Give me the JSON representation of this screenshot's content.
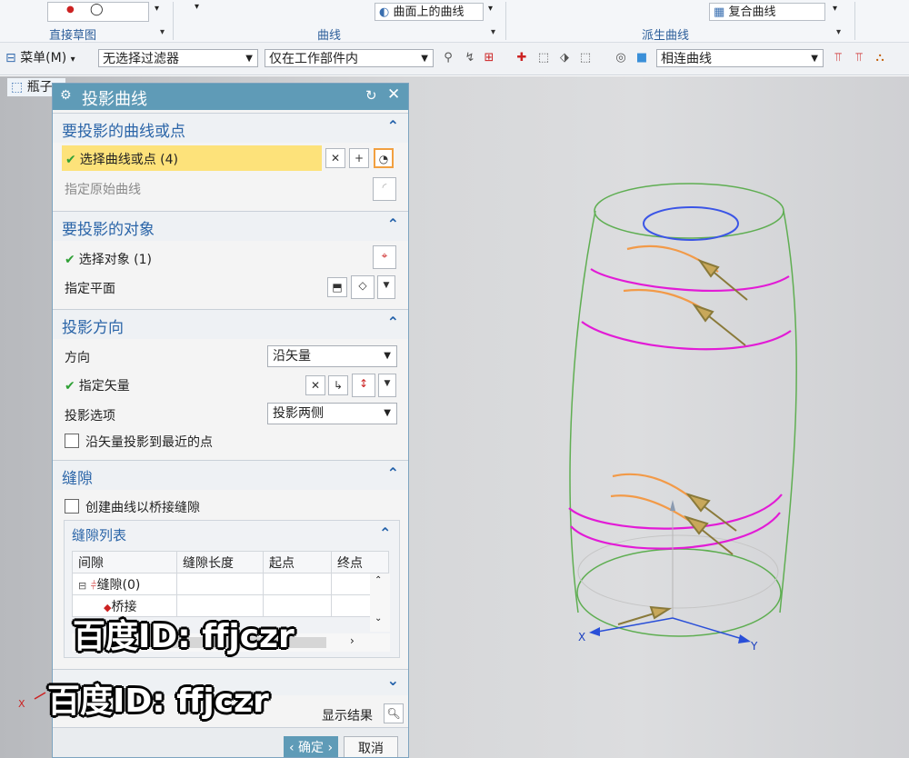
{
  "ribbon": {
    "groups": [
      "直接草图",
      "曲线",
      "派生曲线"
    ],
    "curve_on_surface_label": "曲面上的曲线",
    "composite_curve_label": "复合曲线"
  },
  "toolbar": {
    "menu_label": "菜单(M)",
    "filter_value": "无选择过滤器",
    "scope_value": "仅在工作部件内",
    "curve_rule_value": "相连曲线"
  },
  "part_tab": "瓶子",
  "dialog": {
    "title": "投影曲线",
    "sections": {
      "curves": {
        "title": "要投影的曲线或点",
        "select_label": "选择曲线或点 (4)",
        "specify_original": "指定原始曲线"
      },
      "objects": {
        "title": "要投影的对象",
        "select_label": "选择对象 (1)",
        "specify_plane": "指定平面"
      },
      "direction": {
        "title": "投影方向",
        "direction_label": "方向",
        "direction_value": "沿矢量",
        "vector_label": "指定矢量",
        "option_label": "投影选项",
        "option_value": "投影两侧",
        "nearest_label": "沿矢量投影到最近的点"
      },
      "gap": {
        "title": "缝隙",
        "bridge_label": "创建曲线以桥接缝隙",
        "list_title": "缝隙列表",
        "columns": [
          "间隙",
          "缝隙长度",
          "起点",
          "终点"
        ],
        "rows": [
          "缝隙(0)",
          "桥接"
        ]
      }
    },
    "show_result": "显示结果",
    "ok": "确定",
    "cancel": "取消"
  },
  "watermark": "百度ID: ffjczr",
  "axes": {
    "x": "X",
    "y": "Y"
  },
  "colors": {
    "dialog_title_bg": "#5f9bb7",
    "section_title": "#2b65a8",
    "selected_row": "#fde27a",
    "outline_green": "#5fae52",
    "curve_magenta": "#e21bd6",
    "curve_orange": "#f29a48",
    "circle_blue": "#3b55e6"
  },
  "icons": [
    "gear-icon",
    "reset-icon",
    "close-icon",
    "collapse-up-icon",
    "expand-down-icon",
    "crosshair-icon",
    "vector-icon",
    "search-icon"
  ]
}
